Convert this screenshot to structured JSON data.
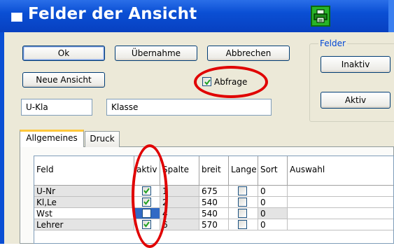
{
  "window": {
    "title": "Felder der Ansicht"
  },
  "buttons": {
    "ok": "Ok",
    "uebernahme": "Übernahme",
    "abbrechen": "Abbrechen",
    "neue_ansicht": "Neue Ansicht",
    "inaktiv": "Inaktiv",
    "aktiv": "Aktiv"
  },
  "felder_group": {
    "label": "Felder"
  },
  "abfrage": {
    "label": "Abfrage",
    "checked": true
  },
  "fields": {
    "short_name": "U-Kla",
    "long_name": "Klasse"
  },
  "tabs": [
    {
      "label": "Allgemeines",
      "active": true
    },
    {
      "label": "Druck",
      "active": false
    }
  ],
  "grid": {
    "columns": [
      "Feld",
      "aktiv",
      "Spalte",
      "breit",
      "Lange",
      "Sort",
      "Auswahl"
    ],
    "rows": [
      {
        "feld": "U-Nr",
        "aktiv": true,
        "spalte": "1",
        "breit": "675",
        "lange": false,
        "sort": "0"
      },
      {
        "feld": "Kl,Le",
        "aktiv": true,
        "spalte": "2",
        "breit": "540",
        "lange": false,
        "sort": "0"
      },
      {
        "feld": "Wst",
        "aktiv": false,
        "spalte": "4",
        "breit": "540",
        "lange": false,
        "sort": "0"
      },
      {
        "feld": "Lehrer",
        "aktiv": true,
        "spalte": "6",
        "breit": "570",
        "lange": false,
        "sort": "0"
      }
    ]
  },
  "icons": {
    "window": "window-icon",
    "print": "printer-icon",
    "check": "checkmark-icon"
  },
  "colors": {
    "titlebar": "#0a4fd4",
    "dialog_bg": "#ece9d8",
    "highlight": "#e00000",
    "print_button": "#28b428",
    "selection": "#316ac5"
  }
}
